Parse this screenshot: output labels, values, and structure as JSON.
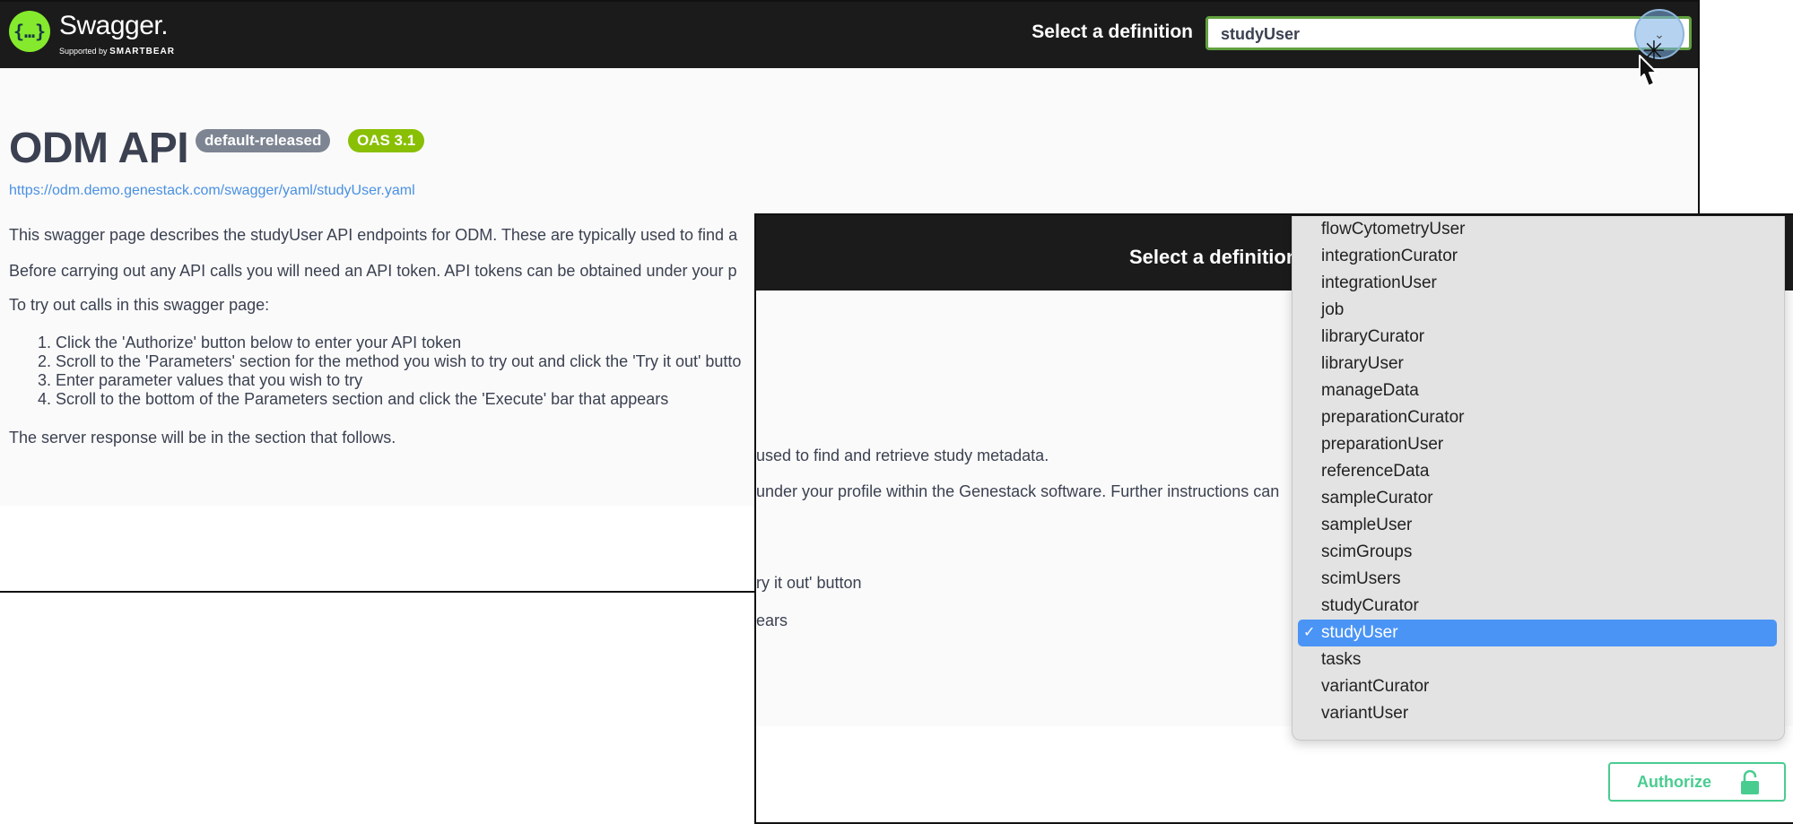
{
  "header": {
    "logo_icon": "{…}",
    "logo_name": "Swagger.",
    "logo_sub_prefix": "Supported by",
    "logo_sub_brand": "SMARTBEAR",
    "select_label": "Select a definition",
    "selected_definition": "studyUser"
  },
  "info": {
    "title": "ODM API",
    "version_badge": "default-released",
    "oas_badge": "OAS 3.1",
    "spec_url": "https://odm.demo.genestack.com/swagger/yaml/studyUser.yaml",
    "description_1": "This swagger page describes the studyUser API endpoints for ODM. These are typically used to find a",
    "description_2": "Before carrying out any API calls you will need an API token. API tokens can be obtained under your p",
    "try_intro": "To try out calls in this swagger page:",
    "steps": [
      "1. Click the 'Authorize' button below to enter your API token",
      "2. Scroll to the 'Parameters' section for the method you wish to try out and click the 'Try it out' butto",
      "3. Enter parameter values that you wish to try",
      "4. Scroll to the bottom of the Parameters section and click the 'Execute' bar that appears"
    ],
    "server_response": "The server response will be in the section that follows."
  },
  "zoomed": {
    "select_label": "Select a definition",
    "fragments": [
      "used to find and retrieve study metadata.",
      "under your profile within the Genestack software. Further instructions can",
      "ry it out' button",
      "ears"
    ],
    "authorize_label": "Authorize"
  },
  "dropdown": {
    "options": [
      "flowCytometryUser",
      "integrationCurator",
      "integrationUser",
      "job",
      "libraryCurator",
      "libraryUser",
      "manageData",
      "preparationCurator",
      "preparationUser",
      "referenceData",
      "sampleCurator",
      "sampleUser",
      "scimGroups",
      "scimUsers",
      "studyCurator",
      "studyUser",
      "tasks",
      "variantCurator",
      "variantUser"
    ],
    "selected": "studyUser",
    "check_mark": "✓"
  },
  "colors": {
    "topbar": "#1b1b1b",
    "swagger_green": "#85ea2d",
    "select_border": "#62a03f",
    "badge_grey": "#7d8492",
    "badge_green": "#89bf04",
    "link_blue": "#4990e2",
    "authorize_green": "#49cc90",
    "selection_blue": "#4a94f6"
  },
  "icons": [
    "swagger-logo-icon",
    "chevron-down-icon",
    "click-burst-icon",
    "pointer-cursor-icon",
    "lock-icon",
    "checkmark-icon"
  ]
}
